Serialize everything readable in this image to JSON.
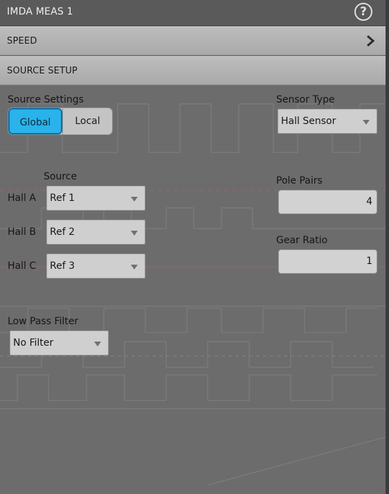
{
  "window": {
    "title": "IMDA MEAS 1"
  },
  "sections": {
    "speed": "SPEED",
    "source_setup": "SOURCE SETUP"
  },
  "source_settings": {
    "label": "Source Settings",
    "options": [
      "Global",
      "Local"
    ],
    "selected": "Global"
  },
  "sensor_type": {
    "label": "Sensor Type",
    "value": "Hall Sensor"
  },
  "source": {
    "header": "Source",
    "rows": [
      {
        "label": "Hall A",
        "value": "Ref 1"
      },
      {
        "label": "Hall B",
        "value": "Ref 2"
      },
      {
        "label": "Hall C",
        "value": "Ref 3"
      }
    ]
  },
  "pole_pairs": {
    "label": "Pole Pairs",
    "value": "4"
  },
  "gear_ratio": {
    "label": "Gear Ratio",
    "value": "1"
  },
  "low_pass_filter": {
    "label": "Low Pass Filter",
    "value": "No Filter"
  },
  "colors": {
    "accent": "#29b3ea",
    "panel_bg": "#6c6c6c",
    "section_bar": "#b3b3b3"
  },
  "icons": {
    "help": "help-icon",
    "expand": "chevron-right-icon",
    "dropdown": "dropdown-arrow-icon"
  }
}
